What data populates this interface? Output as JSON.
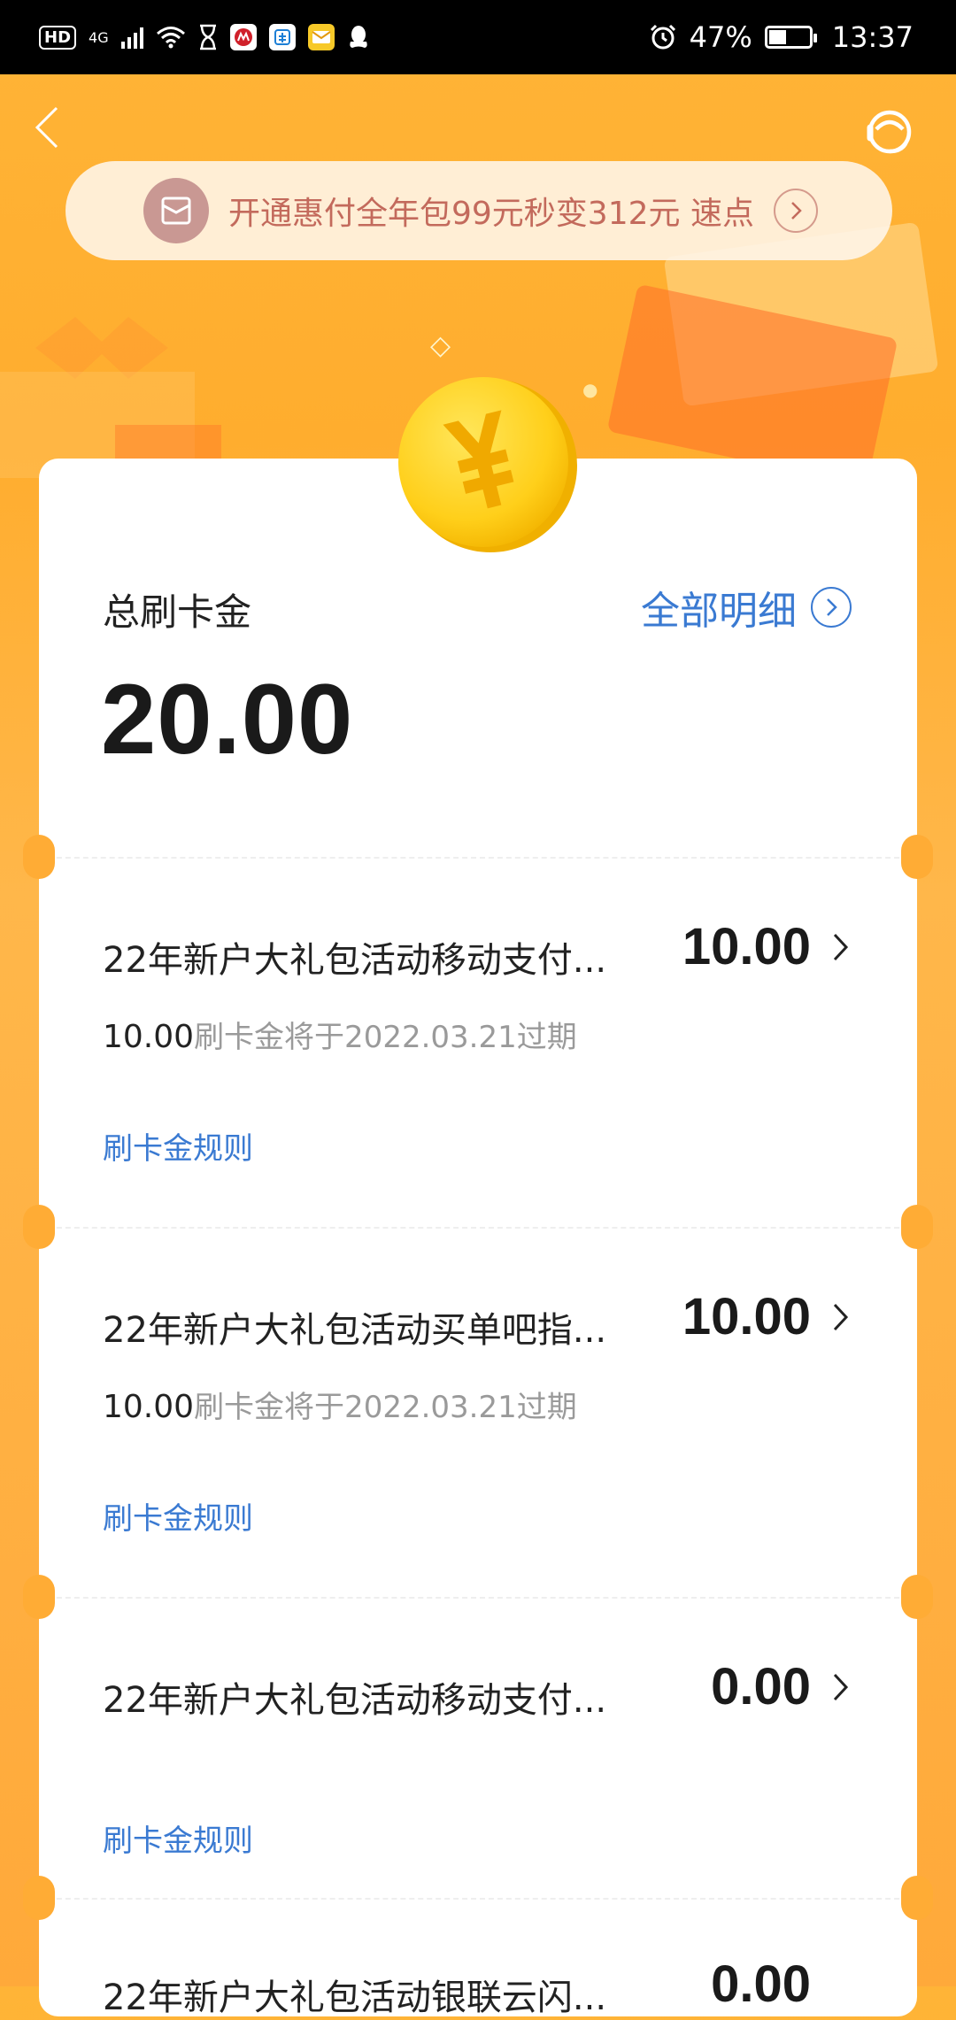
{
  "status_bar": {
    "hd": "HD",
    "network": "4G",
    "battery_percent": "47%",
    "battery_level": 0.47,
    "time": "13:37"
  },
  "promo": {
    "text": "开通惠付全年包99元秒变312元 速点"
  },
  "summary": {
    "label": "总刷卡金",
    "detail_link": "全部明细",
    "amount": "20.00"
  },
  "entries": [
    {
      "title": "22年新户大礼包活动移动支付...",
      "amount": "10.00",
      "expire_amount": "10.00",
      "expire_text": "刷卡金将于2022.03.21过期",
      "rule_link": "刷卡金规则"
    },
    {
      "title": "22年新户大礼包活动买单吧指...",
      "amount": "10.00",
      "expire_amount": "10.00",
      "expire_text": "刷卡金将于2022.03.21过期",
      "rule_link": "刷卡金规则"
    },
    {
      "title": "22年新户大礼包活动移动支付...",
      "amount": "0.00",
      "rule_link": "刷卡金规则"
    },
    {
      "title": "22年新户大礼包活动银联云闪...",
      "amount": "0.00"
    }
  ],
  "colors": {
    "background_orange": "#ffb437",
    "link_blue": "#3a7ad2",
    "promo_text": "#c36a5c",
    "coin_yellow": "#ffd21f"
  }
}
